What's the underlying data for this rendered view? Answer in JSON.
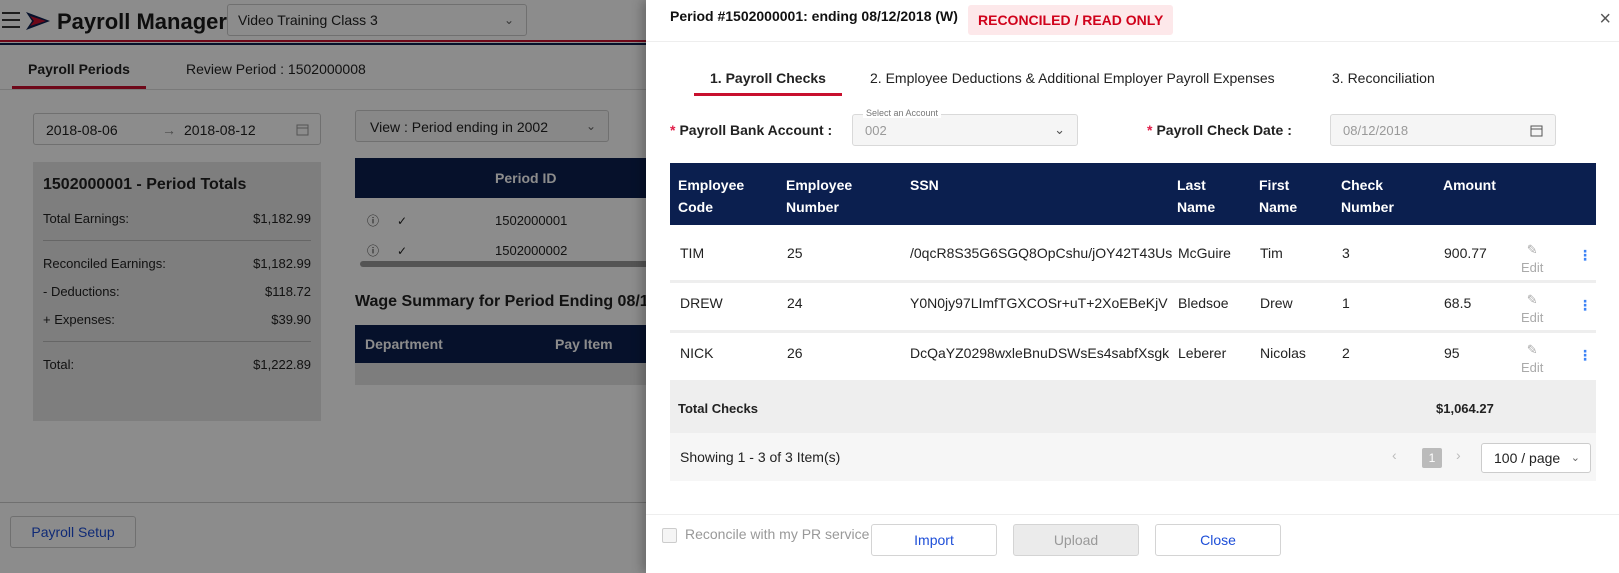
{
  "app": {
    "title": "Payroll Manager",
    "class_select": "Video Training Class 3"
  },
  "bg_tabs": [
    {
      "label": "Payroll Periods"
    },
    {
      "label": "Review Period : 1502000008"
    }
  ],
  "date_range": {
    "start": "2018-08-06",
    "end": "2018-08-12",
    "arrow": "→"
  },
  "totals": {
    "title": "1502000001 - Period Totals",
    "rows": [
      {
        "label": "Total Earnings:",
        "value": "$1,182.99"
      },
      {
        "label": "Reconciled Earnings:",
        "value": "$1,182.99"
      },
      {
        "label": "- Deductions:",
        "value": "$118.72"
      },
      {
        "label": "+ Expenses:",
        "value": "$39.90"
      },
      {
        "label": "Total:",
        "value": "$1,222.89"
      }
    ]
  },
  "view_select": "View : Period ending in 2002",
  "periods": {
    "header": "Period ID",
    "rows": [
      {
        "id": "1502000001"
      },
      {
        "id": "1502000002"
      }
    ]
  },
  "wage_summary": {
    "title": "Wage Summary for Period Ending 08/1",
    "col_department": "Department",
    "col_pay_item": "Pay Item"
  },
  "setup_button": "Payroll Setup",
  "drawer": {
    "title": "Period #1502000001: ending 08/12/2018 (W)",
    "badge": "RECONCILED / READ ONLY",
    "close_icon": "×",
    "tabs": [
      {
        "label": "1. Payroll Checks"
      },
      {
        "label": "2. Employee Deductions & Additional Employer Payroll Expenses"
      },
      {
        "label": "3. Reconciliation"
      }
    ],
    "bank_label": "Payroll Bank Account",
    "bank_legend": "Select an Account",
    "bank_value": "002",
    "date_label": "Payroll Check Date",
    "date_value": "08/12/2018",
    "required_mark": "*",
    "colon": ":",
    "columns": {
      "employee_code": [
        "Employee",
        "Code"
      ],
      "employee_number": [
        "Employee",
        "Number"
      ],
      "ssn": "SSN",
      "last_name": [
        "Last",
        "Name"
      ],
      "first_name": [
        "First",
        "Name"
      ],
      "check_number": [
        "Check",
        "Number"
      ],
      "amount": "Amount"
    },
    "rows": [
      {
        "code": "TIM",
        "number": "25",
        "ssn": "/0qcR8S35G6SGQ8OpCshu/jOY42T43Us",
        "last": "McGuire",
        "first": "Tim",
        "check": "3",
        "amount": "900.77",
        "edit": "Edit"
      },
      {
        "code": "DREW",
        "number": "24",
        "ssn": "Y0N0jy97LImfTGXCOSr+uT+2XoEBeKjV",
        "last": "Bledsoe",
        "first": "Drew",
        "check": "1",
        "amount": "68.5",
        "edit": "Edit"
      },
      {
        "code": "NICK",
        "number": "26",
        "ssn": "DcQaYZ0298wxleBnuDSWsEs4sabfXsgk",
        "last": "Leberer",
        "first": "Nicolas",
        "check": "2",
        "amount": "95",
        "edit": "Edit"
      }
    ],
    "total_label": "Total Checks",
    "total_value": "$1,064.27",
    "showing": "Showing 1 - 3 of 3 Item(s)",
    "current_page": "1",
    "page_size": "100 / page",
    "reconcile_label": "Reconcile with my PR service",
    "buttons": {
      "import": "Import",
      "upload": "Upload",
      "close": "Close"
    }
  }
}
